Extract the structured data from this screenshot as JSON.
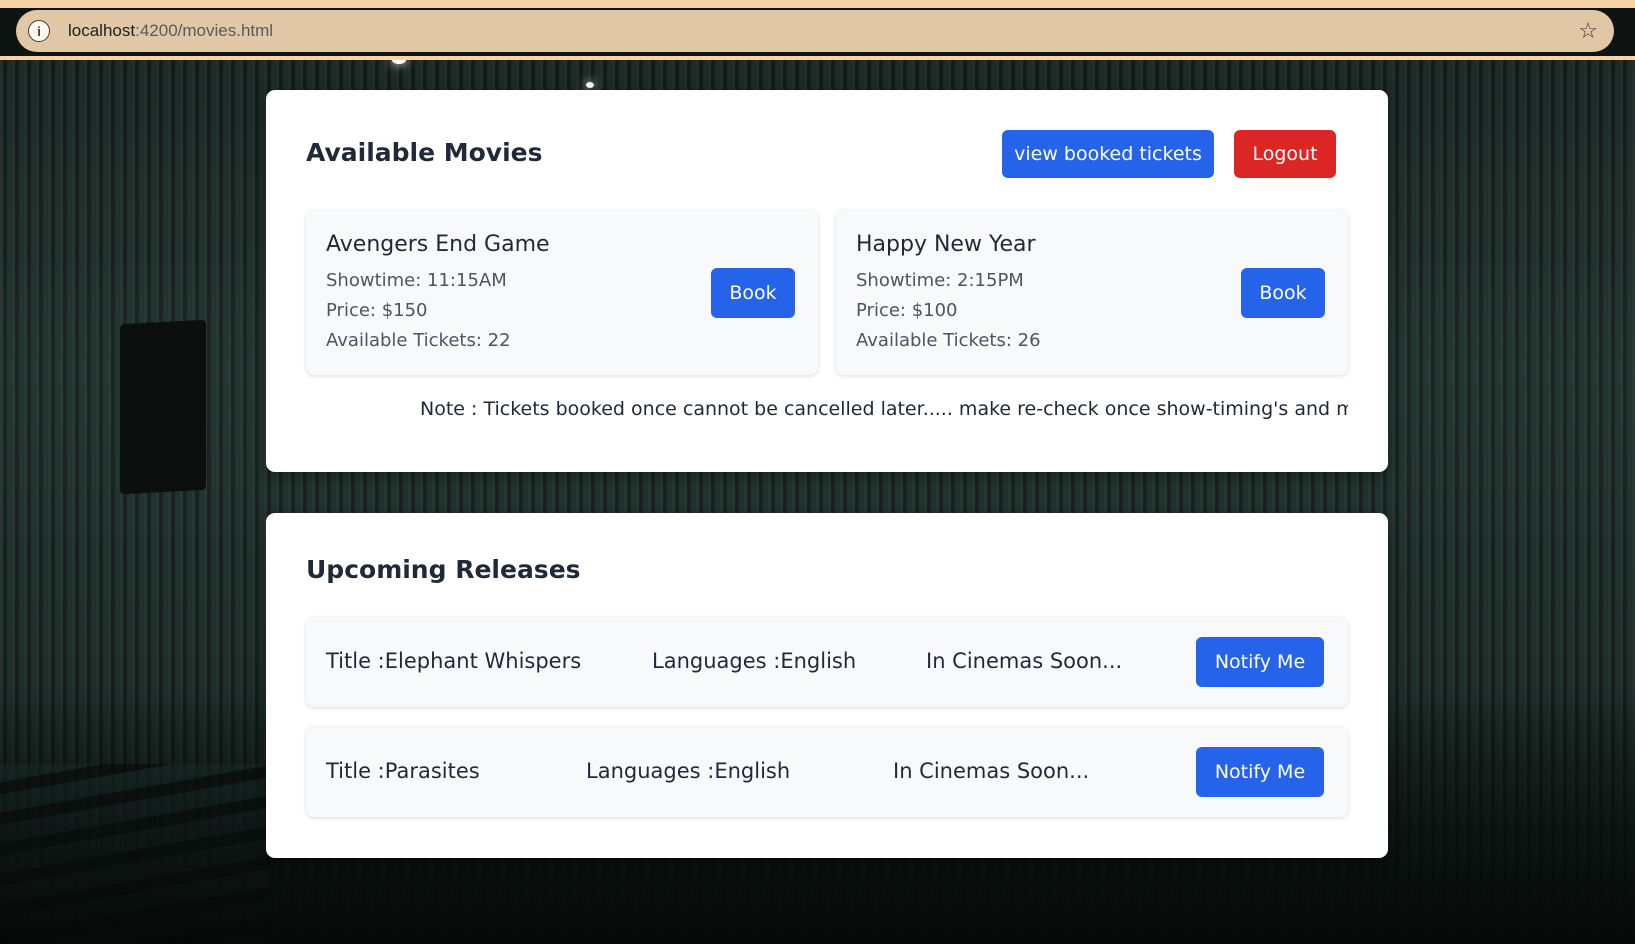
{
  "browser": {
    "url_host": "localhost",
    "url_path": ":4200/movies.html"
  },
  "available": {
    "title": "Available Movies",
    "view_booked_label": "view booked tickets",
    "logout_label": "Logout",
    "movies": [
      {
        "title": "Avengers End Game",
        "showtime": "Showtime: 11:15AM",
        "price": "Price: $150",
        "tickets": "Available Tickets: 22",
        "book_label": "Book"
      },
      {
        "title": "Happy New Year",
        "showtime": "Showtime: 2:15PM",
        "price": "Price: $100",
        "tickets": "Available Tickets: 26",
        "book_label": "Book"
      }
    ],
    "note": "Note : Tickets booked once cannot be cancelled later..... make re-check once show-timing's and movie details"
  },
  "upcoming": {
    "title": "Upcoming Releases",
    "items": [
      {
        "title": "Title :Elephant Whispers",
        "languages": "Languages :English",
        "status": "In Cinemas Soon...",
        "notify_label": "Notify Me"
      },
      {
        "title": "Title :Parasites",
        "languages": "Languages :English",
        "status": "In Cinemas Soon...",
        "notify_label": "Notify Me"
      }
    ]
  },
  "colors": {
    "primary": "#2563eb",
    "danger": "#dc2626",
    "heading": "#1f2937"
  }
}
